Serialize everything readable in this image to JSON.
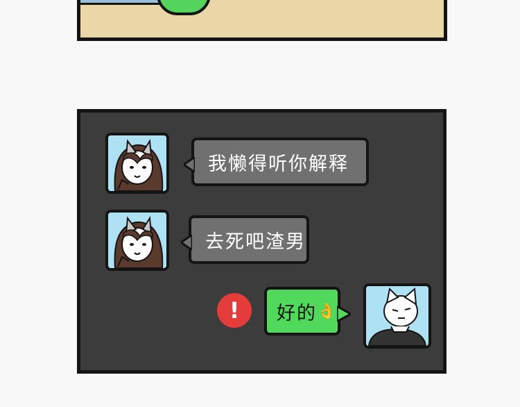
{
  "messages": [
    {
      "side": "left",
      "text": "我懒得听你解释",
      "bubble_color": "#707070"
    },
    {
      "side": "left",
      "text": "去死吧渣男",
      "bubble_color": "#707070"
    },
    {
      "side": "right",
      "text": "好的",
      "emoji": "👌",
      "bubble_color": "#50d95b",
      "status": "!"
    }
  ],
  "colors": {
    "panel_background": "#3c3c3c",
    "page_background": "#f8f8f8",
    "top_panel": "#ead7a8",
    "alert_red": "#e43b3b"
  },
  "icons": {
    "female_avatar": "cat-girl-avatar",
    "male_avatar": "cat-boy-avatar",
    "failed_send": "exclamation-alert-icon",
    "emoji": "ok-hand-emoji"
  }
}
